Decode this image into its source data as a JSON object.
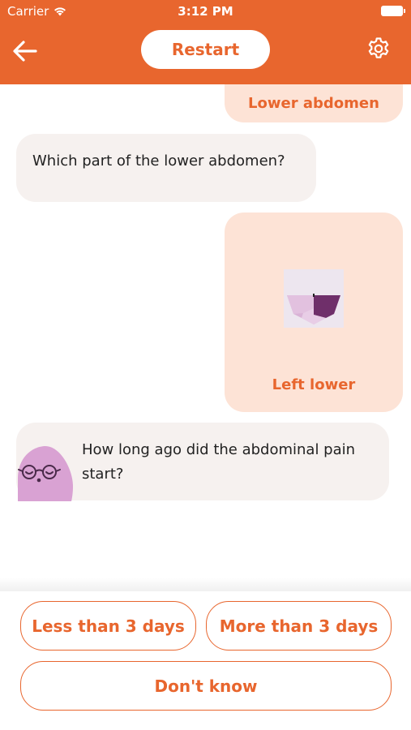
{
  "status_bar": {
    "carrier": "Carrier",
    "time": "3:12 PM"
  },
  "header": {
    "restart_label": "Restart",
    "back_icon": "arrow-left-icon",
    "settings_icon": "gear-icon"
  },
  "colors": {
    "accent": "#e8662e",
    "user_bubble": "#fde3d6",
    "bot_bubble": "#f6f1ef",
    "avatar": "#d9a2d3"
  },
  "chat": {
    "previous_answer": "Lower abdomen",
    "question_1": "Which part of the lower abdomen?",
    "answer_1": "Left lower",
    "question_2": "How long ago did the abdominal pain start?"
  },
  "answers": {
    "less_than_3_days": "Less than 3 days",
    "more_than_3_days": "More than 3 days",
    "dont_know": "Don't know"
  }
}
